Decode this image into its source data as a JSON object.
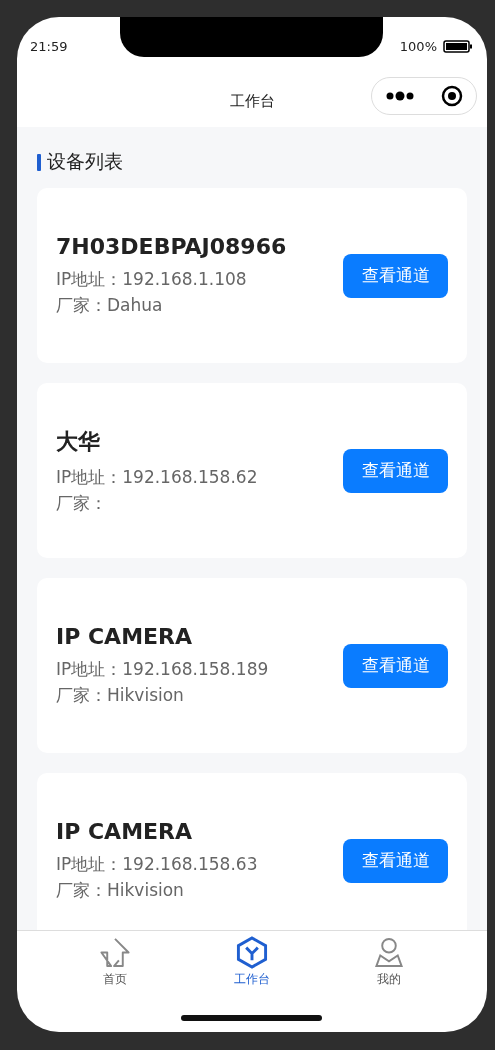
{
  "status_bar": {
    "time": "21:59",
    "battery": "100%"
  },
  "nav": {
    "title": "工作台"
  },
  "section": {
    "title": "设备列表"
  },
  "devices": [
    {
      "name": "7H03DEBPAJ08966",
      "ip": "IP地址：192.168.1.108",
      "vendor": "厂家：Dahua",
      "button": "查看通道"
    },
    {
      "name": "大华",
      "ip": "IP地址：192.168.158.62",
      "vendor": "厂家：",
      "button": "查看通道"
    },
    {
      "name": "IP CAMERA",
      "ip": "IP地址：192.168.158.189",
      "vendor": "厂家：Hikvision",
      "button": "查看通道"
    },
    {
      "name": "IP CAMERA",
      "ip": "IP地址：192.168.158.63",
      "vendor": "厂家：Hikvision",
      "button": "查看通道"
    }
  ],
  "tabs": [
    {
      "kind": "home",
      "label": "首页",
      "selected": false
    },
    {
      "kind": "workbench",
      "label": "工作台",
      "selected": true
    },
    {
      "kind": "profile",
      "label": "我的",
      "selected": false
    }
  ]
}
